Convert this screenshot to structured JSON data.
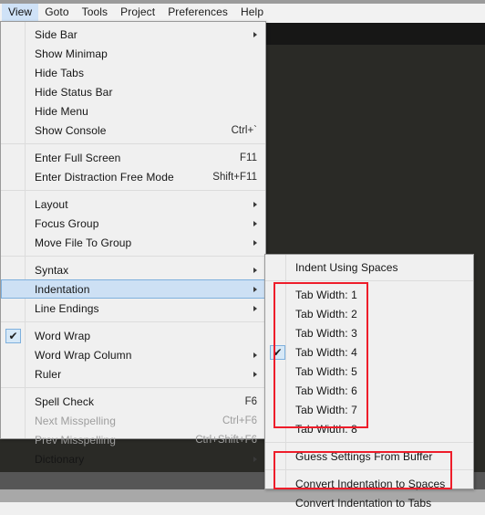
{
  "app": {
    "menubar": [
      {
        "label": "View",
        "active": true
      },
      {
        "label": "Goto",
        "active": false
      },
      {
        "label": "Tools",
        "active": false
      },
      {
        "label": "Project",
        "active": false
      },
      {
        "label": "Preferences",
        "active": false
      },
      {
        "label": "Help",
        "active": false
      }
    ]
  },
  "view_menu": {
    "name": "View",
    "groups": [
      {
        "items": [
          {
            "label": "Side Bar",
            "shortcut": "",
            "submenu": true,
            "checked": false,
            "disabled": false,
            "highlighted": false
          },
          {
            "label": "Show Minimap",
            "shortcut": "",
            "submenu": false,
            "checked": false,
            "disabled": false,
            "highlighted": false
          },
          {
            "label": "Hide Tabs",
            "shortcut": "",
            "submenu": false,
            "checked": false,
            "disabled": false,
            "highlighted": false
          },
          {
            "label": "Hide Status Bar",
            "shortcut": "",
            "submenu": false,
            "checked": false,
            "disabled": false,
            "highlighted": false
          },
          {
            "label": "Hide Menu",
            "shortcut": "",
            "submenu": false,
            "checked": false,
            "disabled": false,
            "highlighted": false
          },
          {
            "label": "Show Console",
            "shortcut": "Ctrl+`",
            "submenu": false,
            "checked": false,
            "disabled": false,
            "highlighted": false
          }
        ]
      },
      {
        "items": [
          {
            "label": "Enter Full Screen",
            "shortcut": "F11",
            "submenu": false,
            "checked": false,
            "disabled": false,
            "highlighted": false
          },
          {
            "label": "Enter Distraction Free Mode",
            "shortcut": "Shift+F11",
            "submenu": false,
            "checked": false,
            "disabled": false,
            "highlighted": false
          }
        ]
      },
      {
        "items": [
          {
            "label": "Layout",
            "shortcut": "",
            "submenu": true,
            "checked": false,
            "disabled": false,
            "highlighted": false
          },
          {
            "label": "Focus Group",
            "shortcut": "",
            "submenu": true,
            "checked": false,
            "disabled": false,
            "highlighted": false
          },
          {
            "label": "Move File To Group",
            "shortcut": "",
            "submenu": true,
            "checked": false,
            "disabled": false,
            "highlighted": false
          }
        ]
      },
      {
        "items": [
          {
            "label": "Syntax",
            "shortcut": "",
            "submenu": true,
            "checked": false,
            "disabled": false,
            "highlighted": false
          },
          {
            "label": "Indentation",
            "shortcut": "",
            "submenu": true,
            "checked": false,
            "disabled": false,
            "highlighted": true
          },
          {
            "label": "Line Endings",
            "shortcut": "",
            "submenu": true,
            "checked": false,
            "disabled": false,
            "highlighted": false
          }
        ]
      },
      {
        "items": [
          {
            "label": "Word Wrap",
            "shortcut": "",
            "submenu": false,
            "checked": true,
            "disabled": false,
            "highlighted": false
          },
          {
            "label": "Word Wrap Column",
            "shortcut": "",
            "submenu": true,
            "checked": false,
            "disabled": false,
            "highlighted": false
          },
          {
            "label": "Ruler",
            "shortcut": "",
            "submenu": true,
            "checked": false,
            "disabled": false,
            "highlighted": false
          }
        ]
      },
      {
        "items": [
          {
            "label": "Spell Check",
            "shortcut": "F6",
            "submenu": false,
            "checked": false,
            "disabled": false,
            "highlighted": false
          },
          {
            "label": "Next Misspelling",
            "shortcut": "Ctrl+F6",
            "submenu": false,
            "checked": false,
            "disabled": true,
            "highlighted": false
          },
          {
            "label": "Prev Misspelling",
            "shortcut": "Ctrl+Shift+F6",
            "submenu": false,
            "checked": false,
            "disabled": true,
            "highlighted": false
          },
          {
            "label": "Dictionary",
            "shortcut": "",
            "submenu": true,
            "checked": false,
            "disabled": false,
            "highlighted": false
          }
        ]
      }
    ]
  },
  "indentation_submenu": {
    "name": "Indentation",
    "groups": [
      {
        "items": [
          {
            "label": "Indent Using Spaces",
            "shortcut": "",
            "submenu": false,
            "checked": false,
            "disabled": false,
            "highlighted": false
          }
        ]
      },
      {
        "items": [
          {
            "label": "Tab Width: 1",
            "shortcut": "",
            "submenu": false,
            "checked": false,
            "disabled": false,
            "highlighted": false
          },
          {
            "label": "Tab Width: 2",
            "shortcut": "",
            "submenu": false,
            "checked": false,
            "disabled": false,
            "highlighted": false
          },
          {
            "label": "Tab Width: 3",
            "shortcut": "",
            "submenu": false,
            "checked": false,
            "disabled": false,
            "highlighted": false
          },
          {
            "label": "Tab Width: 4",
            "shortcut": "",
            "submenu": false,
            "checked": true,
            "disabled": false,
            "highlighted": false
          },
          {
            "label": "Tab Width: 5",
            "shortcut": "",
            "submenu": false,
            "checked": false,
            "disabled": false,
            "highlighted": false
          },
          {
            "label": "Tab Width: 6",
            "shortcut": "",
            "submenu": false,
            "checked": false,
            "disabled": false,
            "highlighted": false
          },
          {
            "label": "Tab Width: 7",
            "shortcut": "",
            "submenu": false,
            "checked": false,
            "disabled": false,
            "highlighted": false
          },
          {
            "label": "Tab Width: 8",
            "shortcut": "",
            "submenu": false,
            "checked": false,
            "disabled": false,
            "highlighted": false
          }
        ]
      },
      {
        "items": [
          {
            "label": "Guess Settings From Buffer",
            "shortcut": "",
            "submenu": false,
            "checked": false,
            "disabled": false,
            "highlighted": false
          }
        ]
      },
      {
        "items": [
          {
            "label": "Convert Indentation to Spaces",
            "shortcut": "",
            "submenu": false,
            "checked": false,
            "disabled": false,
            "highlighted": false
          },
          {
            "label": "Convert Indentation to Tabs",
            "shortcut": "",
            "submenu": false,
            "checked": false,
            "disabled": false,
            "highlighted": false
          }
        ]
      }
    ]
  },
  "icons": {
    "check": "✔",
    "submenu_arrow": "submenu-arrow-icon"
  },
  "colors": {
    "menu_background": "#f0f0f0",
    "menu_border": "#9a9a9a",
    "highlight_fill": "#cde0f4",
    "highlight_border": "#7eb0dd",
    "menubar_active": "#cfe2f7",
    "annotation_red": "#ee1d2a",
    "editor_background": "#2a2a26",
    "tabbar_background": "#171716",
    "statusbar": "#565656",
    "text": "#151515",
    "text_disabled": "#9d9d9d"
  },
  "annotations": [
    {
      "name": "tab-width-group-highlight",
      "color": "#ee1d2a"
    },
    {
      "name": "convert-indentation-group-highlight",
      "color": "#ee1d2a"
    }
  ]
}
